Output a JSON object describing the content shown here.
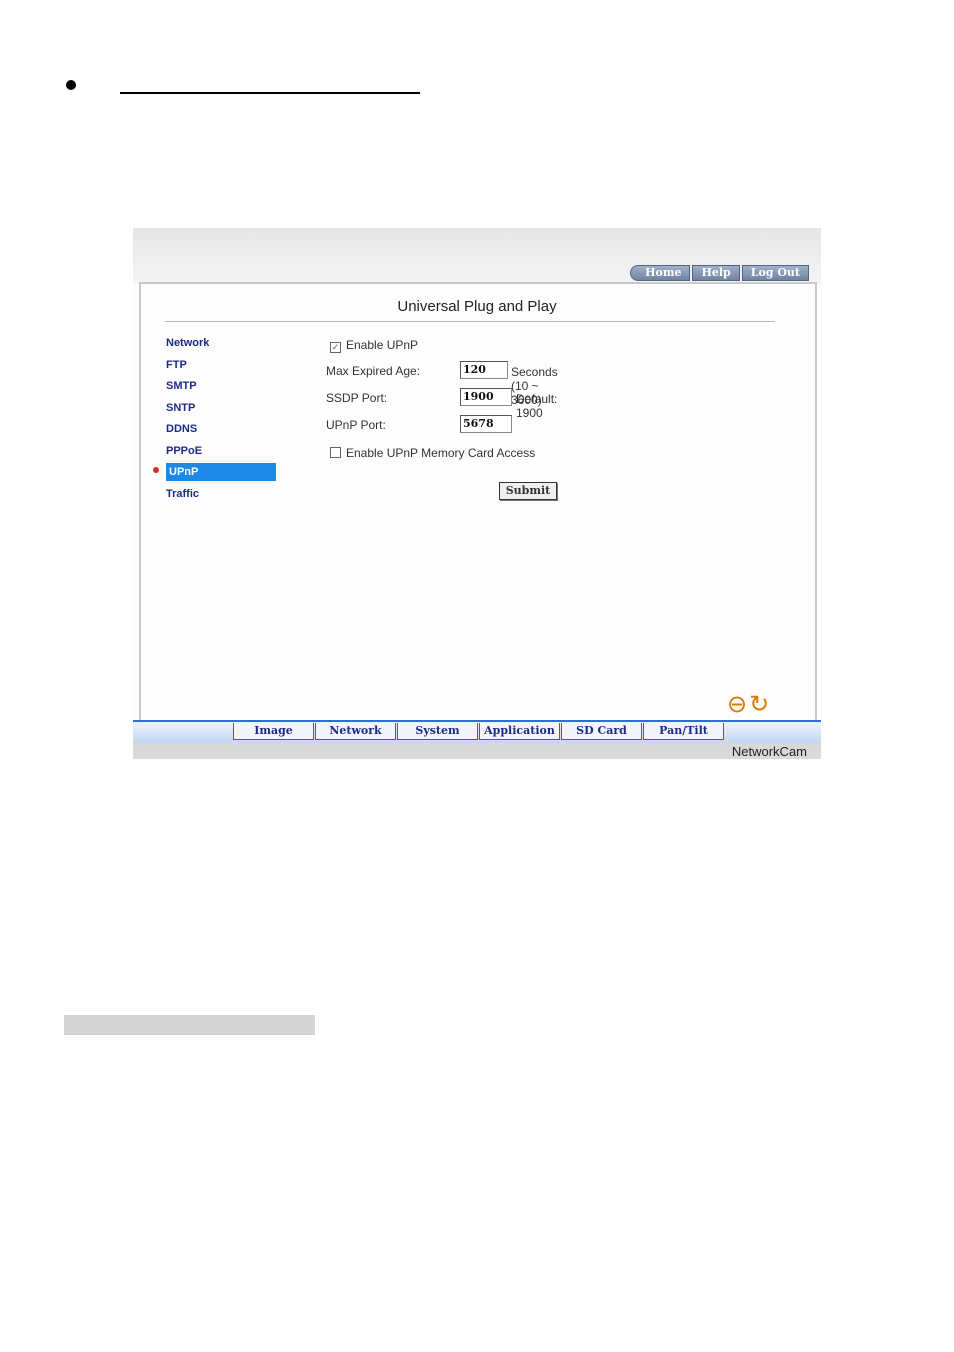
{
  "screenshot": {
    "top_nav": [
      "Home",
      "Help",
      "Log Out"
    ],
    "page_title": "Universal Plug and Play",
    "sidebar": {
      "items": [
        "Network",
        "FTP",
        "SMTP",
        "SNTP",
        "DDNS",
        "PPPoE",
        "UPnP",
        "Traffic"
      ],
      "active": "UPnP"
    },
    "form": {
      "enable_upnp_label": "Enable UPnP",
      "enable_upnp_checked": true,
      "max_age_label": "Max Expired Age:",
      "max_age_value": "120",
      "max_age_hint": "Seconds (10 ~ 3600)",
      "ssdp_port_label": "SSDP Port:",
      "ssdp_port_value": "1900",
      "ssdp_port_hint": "Default: 1900",
      "upnp_port_label": "UPnP Port:",
      "upnp_port_value": "5678",
      "memory_card_label": "Enable UPnP Memory Card Access",
      "memory_card_checked": false,
      "submit_label": "Submit"
    },
    "bottom_nav": [
      "Image",
      "Network",
      "System",
      "Application",
      "SD Card",
      "Pan/Tilt"
    ],
    "brand": "NetworkCam",
    "icons": [
      "back-arrow-icon",
      "refresh-icon"
    ],
    "colors": {
      "active_item": "#1e88e6",
      "link": "#1c2b8a",
      "icon": "#d77a00"
    }
  }
}
